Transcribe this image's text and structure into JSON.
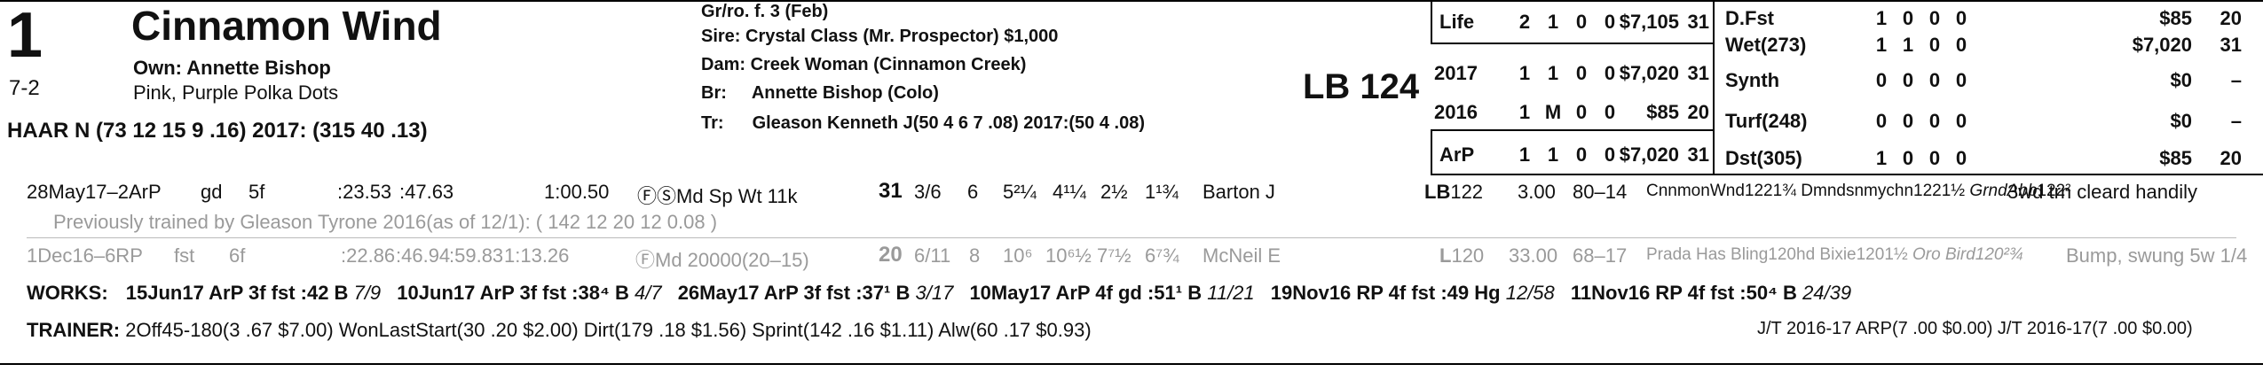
{
  "horse": {
    "post_position": "1",
    "name": "Cinnamon Wind",
    "odds": "7-2",
    "owner": "Own: Annette Bishop",
    "silks": "Pink, Purple Polka Dots",
    "jockey_line": "HAAR N (73 12 15 9 .16) 2017: (315 40 .13)"
  },
  "pedigree": {
    "desc": "Gr/ro. f. 3 (Feb)",
    "sire_label": "Sire:",
    "sire": "Crystal Class (Mr. Prospector) $1,000",
    "dam_label": "Dam:",
    "dam": "Creek Woman (Cinnamon Creek)",
    "breeder_label": "Br:",
    "breeder": "Annette Bishop (Colo)",
    "trainer_label": "Tr:",
    "trainer": "Gleason Kenneth J(50 4 6 7 .08)  2017:(50 4 .08)"
  },
  "weight": "LB 124",
  "record_left": [
    {
      "label": "Life",
      "starts": "2",
      "w": "1",
      "p": "0",
      "s": "0",
      "earn": "$7,105",
      "speed": "31"
    },
    {
      "label": "2017",
      "starts": "1",
      "w": "1",
      "p": "0",
      "s": "0",
      "earn": "$7,020",
      "speed": "31"
    },
    {
      "label": "2016",
      "starts": "1",
      "w": "M",
      "p": "0",
      "s": "0",
      "earn": "$85",
      "speed": "20"
    },
    {
      "label": "ArP",
      "starts": "1",
      "w": "1",
      "p": "0",
      "s": "0",
      "earn": "$7,020",
      "speed": "31"
    }
  ],
  "record_right": [
    {
      "label": "D.Fst",
      "starts": "1",
      "w": "0",
      "p": "0",
      "s": "0",
      "earn": "$85",
      "speed": "20"
    },
    {
      "label": "Wet(273)",
      "starts": "1",
      "w": "1",
      "p": "0",
      "s": "0",
      "earn": "$7,020",
      "speed": "31"
    },
    {
      "label": "Synth",
      "starts": "0",
      "w": "0",
      "p": "0",
      "s": "0",
      "earn": "$0",
      "speed": "–"
    },
    {
      "label": "Turf(248)",
      "starts": "0",
      "w": "0",
      "p": "0",
      "s": "0",
      "earn": "$0",
      "speed": "–"
    },
    {
      "label": "Dst(305)",
      "starts": "1",
      "w": "0",
      "p": "0",
      "s": "0",
      "earn": "$85",
      "speed": "20"
    }
  ],
  "race1": {
    "date": "28May17–2ArP",
    "cond": "gd",
    "dist": "5f",
    "f1": ":23.53",
    "f2": ":47.63",
    "final": "1:00.50",
    "type": "ⒻⓈMd Sp Wt 11k",
    "speed": "31",
    "pp": "3/6",
    "st": "6",
    "c1": "5²¼",
    "c2": "4¹¼",
    "str": "2½",
    "fin": "1¹¾",
    "jockey": "Barton J",
    "med": "LB",
    "wt": "122",
    "odds": "3.00",
    "figs": "80–14",
    "comp1": "CnnmonWnd122",
    "comp1m": "1¾",
    "comp2": "Dmndsnmychn122",
    "comp2m": "1½",
    "comp3": "GrndAbb",
    "comp3w": "122²",
    "comment": "3wd trn cleard handily"
  },
  "prev_trained": "Previously trained by Gleason Tyrone 2016(as of 12/1): ( 142 12 20 12 0.08 )",
  "race2": {
    "date": "1Dec16–6RP",
    "cond": "fst",
    "dist": "6f",
    "f1": ":22.86",
    "f2": ":46.94",
    "f3": ":59.83",
    "final": "1:13.26",
    "type": "ⒻMd 20000(20–15)",
    "speed": "20",
    "pp": "6/11",
    "st": "8",
    "c1": "10⁶",
    "c2": "10⁶½",
    "str": "7⁷½",
    "fin": "6⁷¾",
    "jockey": "McNeil E",
    "med": "L",
    "wt": "120",
    "odds": "33.00",
    "figs": "68–17",
    "comp1": "Prada Has Bling120",
    "comp1m": "hd",
    "comp2": "Bixie120",
    "comp2m": "1½",
    "comp3": "Oro Bird120²¾",
    "comment": "Bump, swung 5w 1/4"
  },
  "works": {
    "label": "WORKS:",
    "items": [
      {
        "text": "15Jun17 ArP 3f fst :42 B",
        "rank": "7/9"
      },
      {
        "text": "10Jun17 ArP 3f fst :38⁴ B",
        "rank": "4/7"
      },
      {
        "text": "26May17 ArP 3f fst :37¹ B",
        "rank": "3/17"
      },
      {
        "text": "10May17 ArP 4f gd :51¹ B",
        "rank": "11/21"
      },
      {
        "text": "19Nov16 RP 4f fst :49 Hg",
        "rank": "12/58"
      },
      {
        "text": "11Nov16 RP 4f fst :50⁴ B",
        "rank": "24/39"
      }
    ]
  },
  "trainer_stats": {
    "label": "TRAINER:",
    "text": "2Off45-180(3 .67 $7.00) WonLastStart(30 .20 $2.00) Dirt(179 .18 $1.56) Sprint(142 .16 $1.11) Alw(60 .17 $0.93)",
    "jt": "J/T 2016-17 ARP(7 .00 $0.00)  J/T 2016-17(7 .00 $0.00)"
  }
}
